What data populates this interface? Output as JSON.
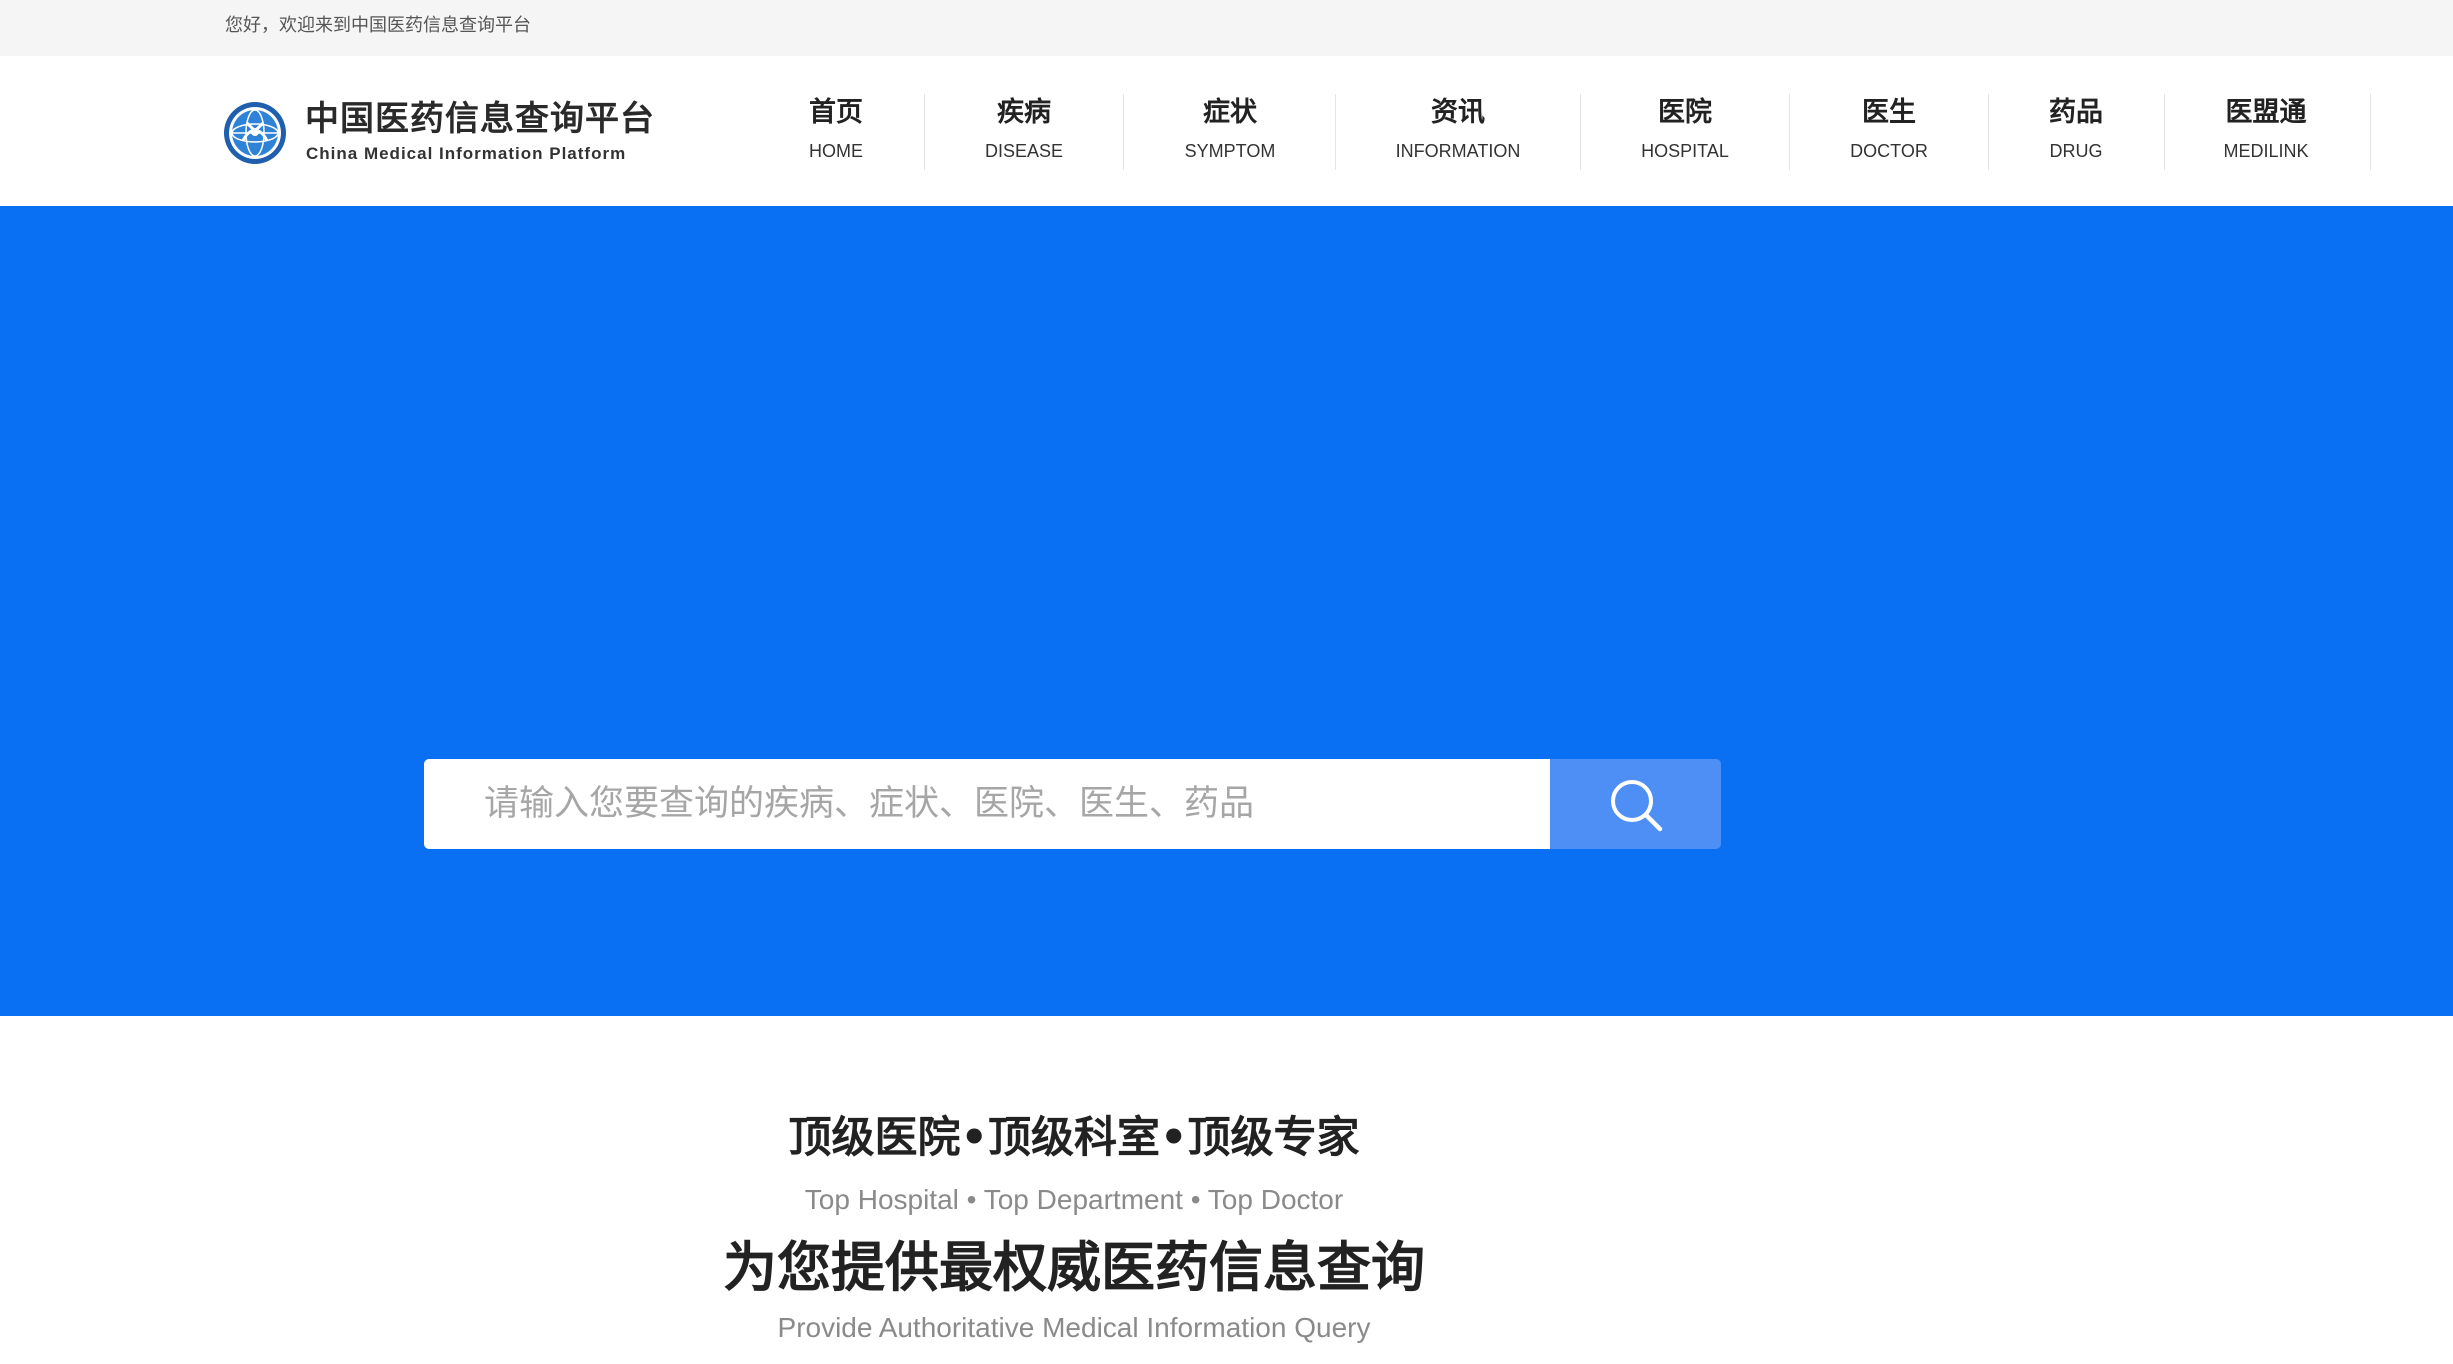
{
  "topbar": {
    "welcome_text": "您好，欢迎来到中国医药信息查询平台"
  },
  "logo": {
    "title_cn": "中国医药信息查询平台",
    "title_en": "China Medical Information Platform",
    "icon": "medical-emblem-icon"
  },
  "nav": {
    "items": [
      {
        "cn": "首页",
        "en": "HOME"
      },
      {
        "cn": "疾病",
        "en": "DISEASE"
      },
      {
        "cn": "症状",
        "en": "SYMPTOM"
      },
      {
        "cn": "资讯",
        "en": "INFORMATION"
      },
      {
        "cn": "医院",
        "en": "HOSPITAL"
      },
      {
        "cn": "医生",
        "en": "DOCTOR"
      },
      {
        "cn": "药品",
        "en": "DRUG"
      },
      {
        "cn": "医盟通",
        "en": "MEDILINK"
      }
    ]
  },
  "search": {
    "placeholder": "请输入您要查询的疾病、症状、医院、医生、药品",
    "value": "",
    "button_icon": "search-icon"
  },
  "tagline": {
    "cn_1": "顶级医院•顶级科室•顶级专家",
    "en_1": "Top Hospital • Top Department • Top Doctor",
    "cn_2": "为您提供最权威医药信息查询",
    "en_2": "Provide Authoritative Medical Information Query"
  },
  "colors": {
    "hero_background": "#0970f4",
    "search_button": "#4d8ff5",
    "topbar_background": "#f5f5f5"
  }
}
